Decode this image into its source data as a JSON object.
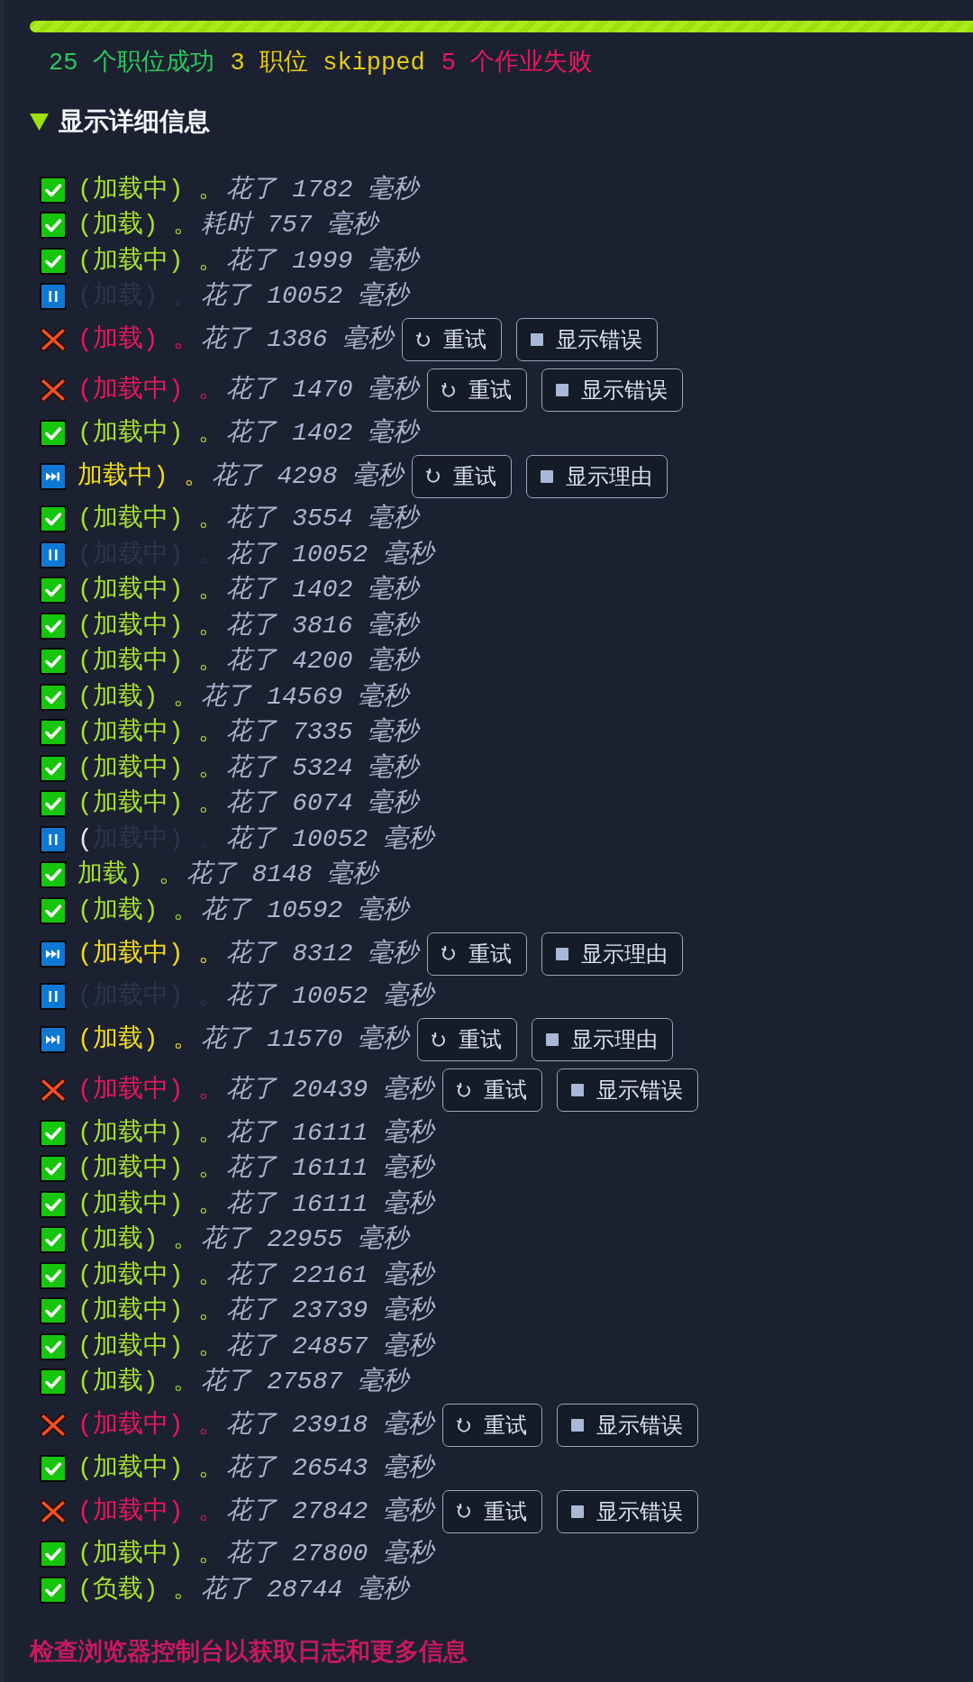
{
  "progress": {
    "level": 1
  },
  "summary": [
    {
      "kind": "success",
      "text": "25 个职位成功"
    },
    {
      "kind": "skipped",
      "text": "3 职位 skipped"
    },
    {
      "kind": "failed",
      "text": "5 个作业失败"
    }
  ],
  "details": {
    "label": "显示详细信息",
    "expanded": true,
    "jobs": [
      {
        "kind": "success",
        "label": "(加载中) 。",
        "time": "花了 1782 毫秒"
      },
      {
        "kind": "success",
        "label": "(加载) 。",
        "time": "耗时 757 毫秒"
      },
      {
        "kind": "success",
        "label": "(加载中) 。",
        "time": "花了 1999 毫秒"
      },
      {
        "kind": "paused",
        "label": "(加载) 。",
        "time": "花了 10052 毫秒"
      },
      {
        "kind": "failed",
        "label": "(加载) 。",
        "time": "花了 1386 毫秒",
        "buttons": [
          {
            "kind": "retry",
            "label": "重试"
          },
          {
            "kind": "show_error",
            "label": "显示错误"
          }
        ]
      },
      {
        "kind": "failed",
        "label": "(加载中) 。",
        "time": "花了 1470 毫秒",
        "buttons": [
          {
            "kind": "retry",
            "label": "重试"
          },
          {
            "kind": "show_error",
            "label": "显示错误"
          }
        ]
      },
      {
        "kind": "success",
        "label": "(加载中) 。",
        "time": "花了 1402 毫秒"
      },
      {
        "kind": "skipped",
        "label": "加载中) 。",
        "time": "花了 4298 毫秒",
        "buttons": [
          {
            "kind": "retry",
            "label": "重试"
          },
          {
            "kind": "show_reason",
            "label": "显示理由"
          }
        ]
      },
      {
        "kind": "success",
        "label": "(加载中) 。",
        "time": "花了 3554 毫秒"
      },
      {
        "kind": "paused",
        "label": "(加载中) 。",
        "time": "花了 10052 毫秒"
      },
      {
        "kind": "success",
        "label": "(加载中) 。",
        "time": "花了 1402 毫秒"
      },
      {
        "kind": "success",
        "label": "(加载中) 。",
        "time": "花了 3816 毫秒"
      },
      {
        "kind": "success",
        "label": "(加载中) 。",
        "time": "花了 4200 毫秒"
      },
      {
        "kind": "success",
        "label": "(加载) 。",
        "time": "花了 14569 毫秒"
      },
      {
        "kind": "success",
        "label": "(加载中) 。",
        "time": "花了 7335 毫秒"
      },
      {
        "kind": "success",
        "label": "(加载中) 。",
        "time": "花了 5324 毫秒"
      },
      {
        "kind": "success",
        "label": "(加载中) 。",
        "time": "花了 6074 毫秒"
      },
      {
        "kind": "paused",
        "lead": "(",
        "label": "加载中) 。",
        "time": "花了 10052 毫秒"
      },
      {
        "kind": "success",
        "label": "加载) 。",
        "time": "花了 8148 毫秒"
      },
      {
        "kind": "success",
        "label": "(加载) 。",
        "time": "花了 10592 毫秒"
      },
      {
        "kind": "skipped",
        "label": "(加载中) 。",
        "time": "花了 8312 毫秒",
        "buttons": [
          {
            "kind": "retry",
            "label": "重试"
          },
          {
            "kind": "show_reason",
            "label": "显示理由"
          }
        ]
      },
      {
        "kind": "paused",
        "label": "(加载中) 。",
        "time": "花了 10052 毫秒"
      },
      {
        "kind": "skipped",
        "label": "(加载) 。",
        "time": "花了 11570 毫秒",
        "buttons": [
          {
            "kind": "retry",
            "label": "重试"
          },
          {
            "kind": "show_reason",
            "label": "显示理由"
          }
        ]
      },
      {
        "kind": "failed",
        "label": "(加载中) 。",
        "time": "花了 20439 毫秒",
        "buttons": [
          {
            "kind": "retry",
            "label": "重试"
          },
          {
            "kind": "show_error",
            "label": "显示错误"
          }
        ]
      },
      {
        "kind": "success",
        "label": "(加载中) 。",
        "time": "花了 16111 毫秒"
      },
      {
        "kind": "success",
        "label": "(加载中) 。",
        "time": "花了 16111 毫秒"
      },
      {
        "kind": "success",
        "label": "(加载中) 。",
        "time": "花了 16111 毫秒"
      },
      {
        "kind": "success",
        "label": "(加载) 。",
        "time": "花了 22955 毫秒"
      },
      {
        "kind": "success",
        "label": "(加载中) 。",
        "time": "花了 22161 毫秒"
      },
      {
        "kind": "success",
        "label": "(加载中) 。",
        "time": "花了 23739 毫秒"
      },
      {
        "kind": "success",
        "label": "(加载中) 。",
        "time": "花了 24857 毫秒"
      },
      {
        "kind": "success",
        "label": "(加载) 。",
        "time": "花了 27587 毫秒"
      },
      {
        "kind": "failed",
        "label": "(加载中) 。",
        "time": "花了 23918 毫秒",
        "buttons": [
          {
            "kind": "retry",
            "label": "重试"
          },
          {
            "kind": "show_error",
            "label": "显示错误"
          }
        ]
      },
      {
        "kind": "success",
        "label": "(加载中) 。",
        "time": "花了 26543 毫秒"
      },
      {
        "kind": "failed",
        "label": "(加载中) 。",
        "time": "花了 27842 毫秒",
        "buttons": [
          {
            "kind": "retry",
            "label": "重试"
          },
          {
            "kind": "show_error",
            "label": "显示错误"
          }
        ]
      },
      {
        "kind": "success",
        "label": "(加载中) 。",
        "time": "花了 27800 毫秒"
      },
      {
        "kind": "success",
        "label": "(负载) 。",
        "time": "花了 28744 毫秒"
      }
    ]
  },
  "footer": "检查浏览器控制台以获取日志和更多信息"
}
